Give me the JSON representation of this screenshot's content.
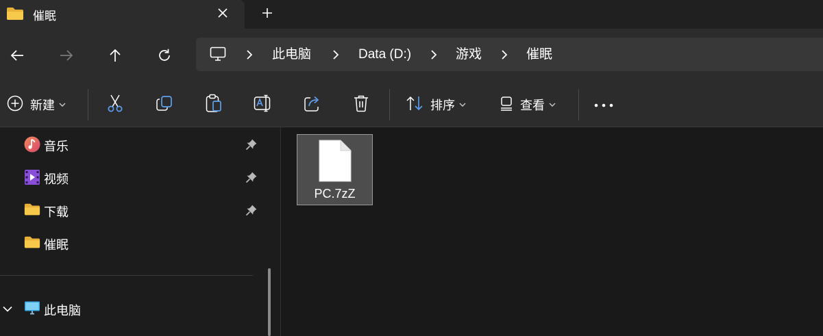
{
  "tab": {
    "title": "催眠",
    "close_icon": "close-icon",
    "new_tab_icon": "plus-icon"
  },
  "nav": {
    "back_icon": "arrow-left-icon",
    "forward_icon": "arrow-right-icon",
    "up_icon": "arrow-up-icon",
    "refresh_icon": "refresh-icon"
  },
  "breadcrumb": {
    "root_icon": "monitor-icon",
    "items": [
      "此电脑",
      "Data (D:)",
      "游戏",
      "催眠"
    ]
  },
  "toolbar": {
    "new_label": "新建",
    "sort_label": "排序",
    "view_label": "查看",
    "icons": [
      "cut-icon",
      "copy-icon",
      "paste-icon",
      "rename-icon",
      "share-icon",
      "delete-icon"
    ],
    "more_icon": "more-icon"
  },
  "sidebar": {
    "items": [
      {
        "label": "音乐",
        "icon": "music-icon",
        "pinned": true
      },
      {
        "label": "视频",
        "icon": "video-icon",
        "pinned": true
      },
      {
        "label": "下载",
        "icon": "folder-icon",
        "pinned": true
      },
      {
        "label": "催眠",
        "icon": "folder-icon",
        "pinned": false
      }
    ],
    "this_pc": {
      "label": "此电脑",
      "icon": "monitor-icon",
      "expanded": true
    }
  },
  "files": [
    {
      "name": "PC.7zZ",
      "icon": "document-icon",
      "selected": true
    }
  ],
  "colors": {
    "accent_folder": "#f7c94b",
    "background": "#1c1c1c",
    "toolbar_icon": "#5ea0ef"
  }
}
